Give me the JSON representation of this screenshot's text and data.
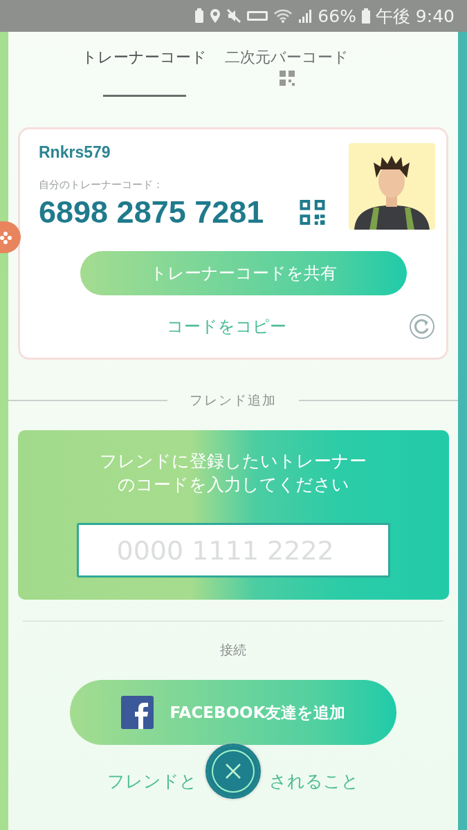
{
  "status_bar": {
    "battery": "66%",
    "time": "午後 9:40"
  },
  "tabs": [
    {
      "label": "トレーナーコード",
      "selected": true,
      "kind": "text"
    },
    {
      "label": "二次元バーコード",
      "selected": false,
      "kind": "qr"
    }
  ],
  "trainer_card": {
    "name": "Rnkrs579",
    "code_label": "自分のトレーナーコード：",
    "code": "6898 2875 7281",
    "share_button": "トレーナーコードを共有",
    "copy_link": "コードをコピー"
  },
  "add_friend": {
    "heading": "フレンド追加",
    "prompt": "フレンドに登録したいトレーナーのコードを入力してください",
    "input": {
      "placeholder": "0000 1111 2222"
    }
  },
  "connect": {
    "heading": "接続",
    "facebook_button": "FACEBOOK友達を追加"
  },
  "footer_link": [
    "フレンドと",
    "されること"
  ]
}
